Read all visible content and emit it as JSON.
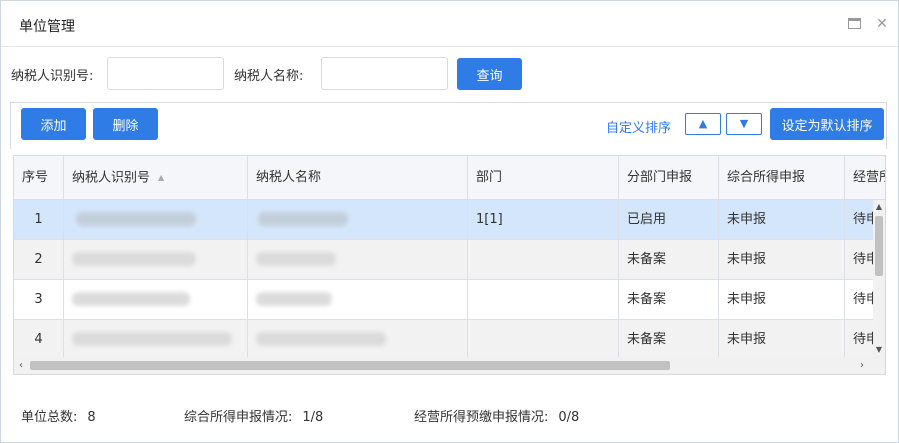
{
  "window": {
    "title": "单位管理"
  },
  "search": {
    "taxpayer_id_label": "纳税人识别号:",
    "taxpayer_id_value": "",
    "taxpayer_name_label": "纳税人名称:",
    "taxpayer_name_value": "",
    "query_label": "查询"
  },
  "toolbar": {
    "add_label": "添加",
    "delete_label": "删除",
    "custom_sort_label": "自定义排序",
    "up_label": "▲",
    "down_label": "▼",
    "set_default_label": "设定为默认排序"
  },
  "table": {
    "columns": [
      "序号",
      "纳税人识别号",
      "纳税人名称",
      "部门",
      "分部门申报",
      "综合所得申报",
      "经营所"
    ],
    "rows": [
      {
        "seq": "1",
        "dept": "1[1]",
        "branch_report": "已启用",
        "comprehensive": "未申报",
        "business": "待申"
      },
      {
        "seq": "2",
        "dept": "",
        "branch_report": "未备案",
        "comprehensive": "未申报",
        "business": "待申"
      },
      {
        "seq": "3",
        "dept": "",
        "branch_report": "未备案",
        "comprehensive": "未申报",
        "business": "待申"
      },
      {
        "seq": "4",
        "dept": "",
        "branch_report": "未备案",
        "comprehensive": "未申报",
        "business": "待申"
      }
    ]
  },
  "status": {
    "unit_total_label": "单位总数:",
    "unit_total_value": "8",
    "comprehensive_label": "综合所得申报情况:",
    "comprehensive_value": "1/8",
    "business_label": "经营所得预缴申报情况:",
    "business_value": "0/8"
  },
  "icons": {
    "maximize": "maximize-icon",
    "close": "close-icon",
    "sort": "sort-asc-icon"
  },
  "colors": {
    "accent": "#2f7ce6",
    "selected_row": "#d3e6fb",
    "alt_row": "#f2f2f2"
  }
}
